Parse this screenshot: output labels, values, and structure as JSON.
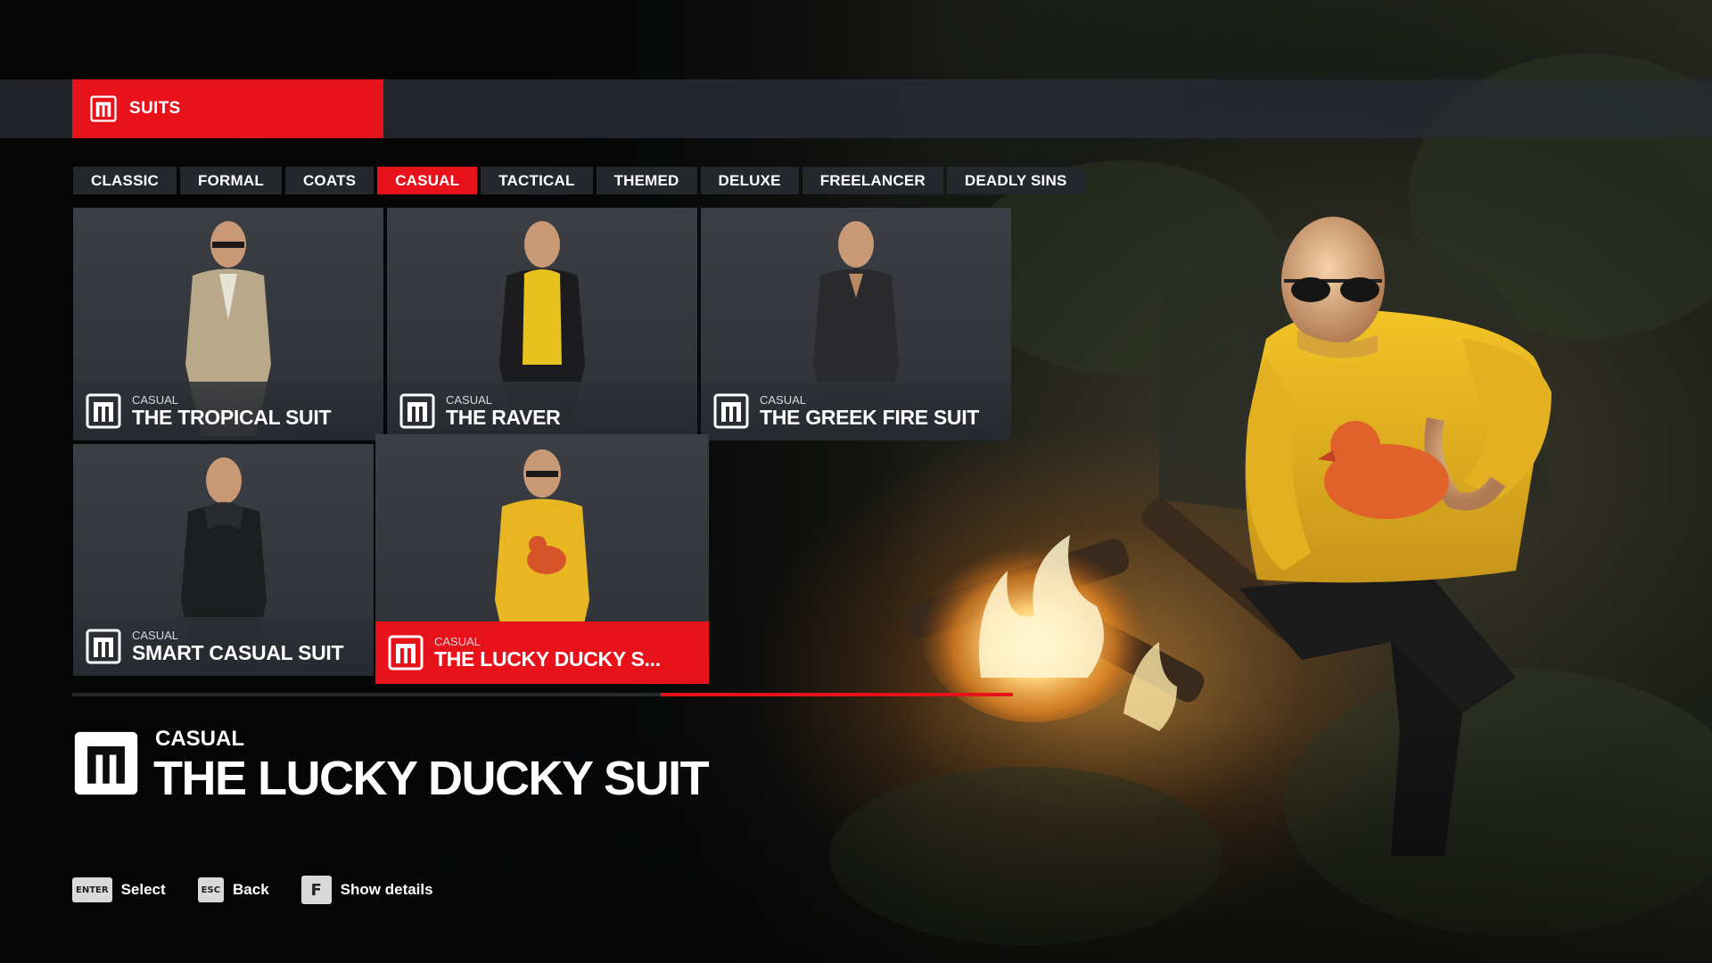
{
  "header": {
    "title": "SUITS"
  },
  "categories": [
    "CLASSIC",
    "FORMAL",
    "COATS",
    "CASUAL",
    "TACTICAL",
    "THEMED",
    "DELUXE",
    "FREELANCER",
    "DEADLY SINS"
  ],
  "active_category": "CASUAL",
  "suits": [
    {
      "category": "CASUAL",
      "name": "THE TROPICAL SUIT",
      "selected": false
    },
    {
      "category": "CASUAL",
      "name": "THE RAVER",
      "selected": false
    },
    {
      "category": "CASUAL",
      "name": "THE GREEK FIRE SUIT",
      "selected": false
    },
    {
      "category": "CASUAL",
      "name": "SMART CASUAL SUIT",
      "selected": false
    },
    {
      "category": "CASUAL",
      "name": "THE LUCKY DUCKY S...",
      "selected": true
    }
  ],
  "scroll_progress": 0.375,
  "details": {
    "category": "CASUAL",
    "name": "THE LUCKY DUCKY SUIT"
  },
  "hints": [
    {
      "key": "ENTER",
      "label": "Select"
    },
    {
      "key": "ESC",
      "label": "Back"
    },
    {
      "key": "F",
      "label": "Show details"
    }
  ],
  "colors": {
    "accent": "#e8121a",
    "panel": "#24272c",
    "card": "#3b3e44"
  },
  "icons": {
    "brand": "hitman-logo-icon"
  }
}
